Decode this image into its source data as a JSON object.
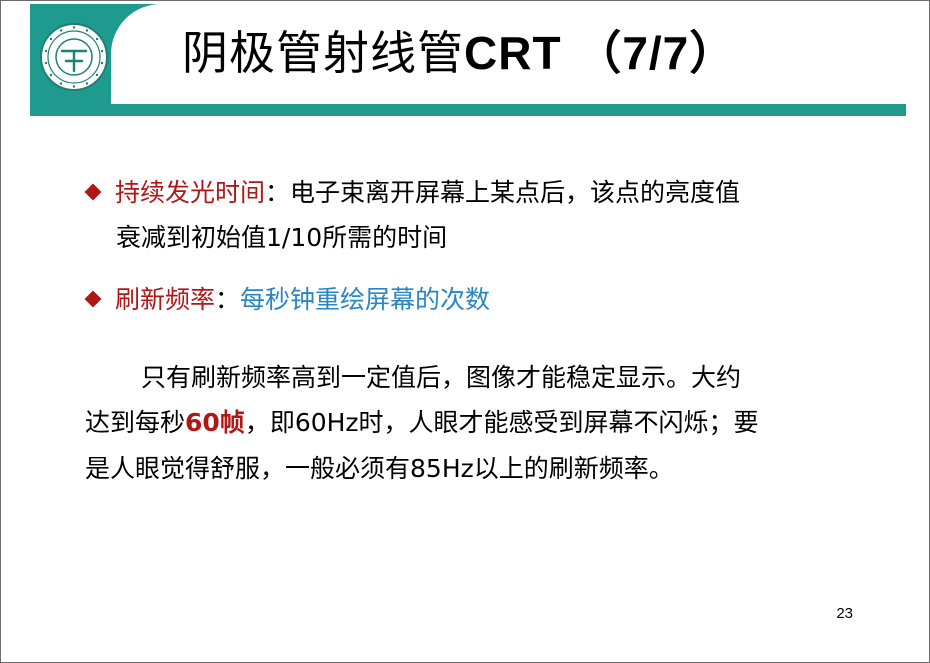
{
  "title": {
    "cn": "阴极管射线管",
    "latin": "CRT （7/7）"
  },
  "bullets": [
    {
      "term": "持续发光时间",
      "sep": "：",
      "def_line1": "电子束离开屏幕上某点后，该点的亮度值",
      "def_line2": "衰减到初始值1/10所需的时间"
    },
    {
      "term": "刷新频率",
      "sep": "：",
      "def": "每秒钟重绘屏幕的次数"
    }
  ],
  "paragraph": {
    "line1": "只有刷新频率高到一定值后，图像才能稳定显示。大约",
    "line2_prefix": "达到每秒",
    "line2_highlight": "60帧",
    "line2_suffix": "，即60Hz时，人眼才能感受到屏幕不闪烁；要",
    "line3": "是人眼觉得舒服，一般必须有85Hz以上的刷新频率。"
  },
  "page_number": "23",
  "colors": {
    "teal": "#1f9a8e",
    "term_red": "#b01818",
    "term_blue": "#2a86c2"
  },
  "icons": {
    "logo": "university-seal-icon",
    "bullet": "diamond-bullet-icon"
  }
}
